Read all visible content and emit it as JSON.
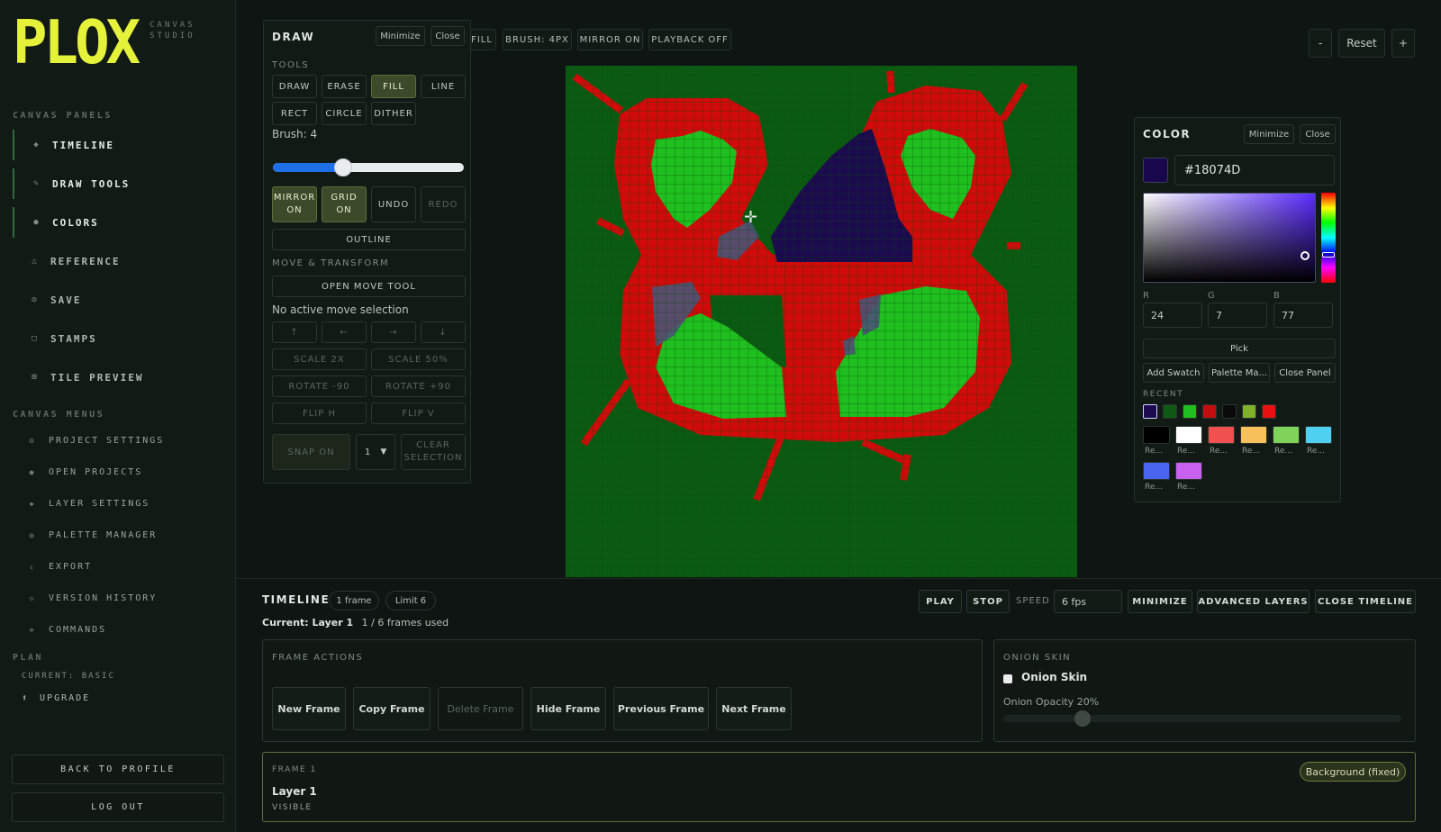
{
  "brand": {
    "logo_text": "PLOX",
    "subtitle_line1": "CANVAS",
    "subtitle_line2": "STUDIO"
  },
  "sidebar": {
    "canvas_panels_heading": "CANVAS PANELS",
    "panels": [
      {
        "label": "TIMELINE",
        "icon": "diamond-icon",
        "active": true
      },
      {
        "label": "DRAW TOOLS",
        "icon": "pencil-icon",
        "active": true
      },
      {
        "label": "COLORS",
        "icon": "dot-icon",
        "active": true
      },
      {
        "label": "REFERENCE",
        "icon": "triangle-icon",
        "active": false
      },
      {
        "label": "SAVE",
        "icon": "ring-icon",
        "active": false
      },
      {
        "label": "STAMPS",
        "icon": "square-icon",
        "active": false
      },
      {
        "label": "TILE PREVIEW",
        "icon": "grid-icon",
        "active": false
      }
    ],
    "canvas_menus_heading": "CANVAS MENUS",
    "menus": [
      {
        "label": "PROJECT SETTINGS",
        "icon": "gear-icon"
      },
      {
        "label": "OPEN PROJECTS",
        "icon": "dot-icon"
      },
      {
        "label": "LAYER SETTINGS",
        "icon": "diamond-icon"
      },
      {
        "label": "PALETTE MANAGER",
        "icon": "palette-icon"
      },
      {
        "label": "EXPORT",
        "icon": "download-icon"
      },
      {
        "label": "VERSION HISTORY",
        "icon": "history-icon"
      },
      {
        "label": "COMMANDS",
        "icon": "lines-icon"
      }
    ],
    "plan_heading": "PLAN",
    "plan_current": "CURRENT: BASIC",
    "upgrade_label": "UPGRADE",
    "back_to_profile": "BACK TO PROFILE",
    "log_out": "LOG OUT"
  },
  "draw_panel": {
    "title": "DRAW",
    "minimize": "Minimize",
    "close": "Close",
    "tools_heading": "TOOLS",
    "tools": [
      "DRAW",
      "ERASE",
      "FILL",
      "LINE",
      "RECT",
      "CIRCLE",
      "DITHER"
    ],
    "active_tool": "FILL",
    "brush_label": "Brush: 4",
    "brush_value": 4,
    "brush_fraction": 0.37,
    "mirror_line1": "MIRROR",
    "mirror_line2": "ON",
    "grid_line1": "GRID",
    "grid_line2": "ON",
    "undo": "UNDO",
    "redo": "REDO",
    "outline": "OUTLINE",
    "move_heading": "MOVE & TRANSFORM",
    "open_move_tool": "OPEN MOVE TOOL",
    "move_status": "No active move selection",
    "arrows": [
      "↑",
      "←",
      "→",
      "↓"
    ],
    "scale_2x": "SCALE 2X",
    "scale_50": "SCALE 50%",
    "rotate_neg": "ROTATE -90",
    "rotate_pos": "ROTATE +90",
    "flip_h": "FLIP H",
    "flip_v": "FLIP V",
    "snap_on": "SNAP ON",
    "snap_value": "1",
    "clear_line1": "CLEAR",
    "clear_line2": "SELECTION"
  },
  "toolbar": {
    "chips": [
      "FILL",
      "BRUSH: 4PX",
      "MIRROR ON",
      "PLAYBACK OFF"
    ],
    "zoom_out": "-",
    "reset": "Reset",
    "zoom_in": "+"
  },
  "canvas": {
    "background_color": "#0b5a12",
    "grid_color": "#0a4a10",
    "colors": {
      "red": "#d10a0a",
      "green": "#1fbf1f",
      "navy": "#1b0a4d",
      "checker": "#4a5476"
    }
  },
  "color_panel": {
    "title": "COLOR",
    "minimize": "Minimize",
    "close": "Close",
    "hex": "#18074D",
    "r_label": "R",
    "g_label": "G",
    "b_label": "B",
    "r": "24",
    "g": "7",
    "b": "77",
    "pick": "Pick",
    "add_swatch": "Add Swatch",
    "palette_manager": "Palette Ma...",
    "close_panel": "Close Panel",
    "recent_heading": "RECENT",
    "recent": [
      "#1b0a4d",
      "#0e5a14",
      "#1fbf1f",
      "#c40e0e",
      "#0a0a0a",
      "#7fb22a",
      "#e81010"
    ],
    "swatches": [
      {
        "color": "#000000",
        "label": "Re..."
      },
      {
        "color": "#ffffff",
        "label": "Re..."
      },
      {
        "color": "#f05050",
        "label": "Re..."
      },
      {
        "color": "#f7c05a",
        "label": "Re..."
      },
      {
        "color": "#7fd35a",
        "label": "Re..."
      },
      {
        "color": "#4fd0f0",
        "label": "Re..."
      },
      {
        "color": "#4a66f0",
        "label": "Re..."
      },
      {
        "color": "#c860f0",
        "label": "Re..."
      }
    ]
  },
  "timeline": {
    "title": "TIMELINE",
    "frames_pill": "1 frame",
    "limit_pill": "Limit 6",
    "current_label": "Current: Layer 1",
    "frames_used": "1 / 6 frames used",
    "play": "PLAY",
    "stop": "STOP",
    "speed_label": "SPEED",
    "speed_value": "6 fps",
    "minimize": "MINIMIZE",
    "advanced_layers": "ADVANCED LAYERS",
    "close_timeline": "CLOSE TIMELINE",
    "frame_actions_heading": "FRAME ACTIONS",
    "frame_actions": [
      "New Frame",
      "Copy Frame",
      "Delete Frame",
      "Hide Frame",
      "Previous Frame",
      "Next Frame"
    ],
    "onion_heading": "ONION SKIN",
    "onion_label": "Onion Skin",
    "onion_opacity_label": "Onion Opacity 20%",
    "onion_opacity": 0.2,
    "frame_label": "FRAME 1",
    "layer_name": "Layer 1",
    "layer_visibility": "VISIBLE",
    "background_pill": "Background (fixed)"
  }
}
